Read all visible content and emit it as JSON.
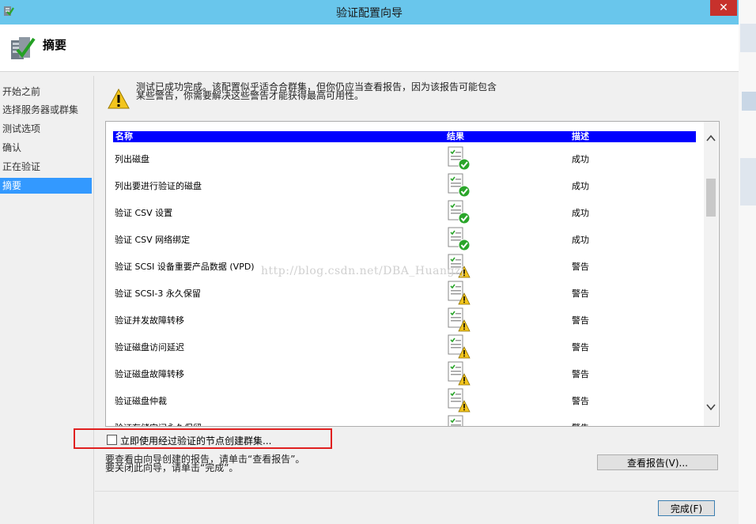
{
  "window": {
    "title": "验证配置向导",
    "close_glyph": "✕"
  },
  "header": {
    "page_title": "摘要"
  },
  "nav": {
    "items": [
      "开始之前",
      "选择服务器或群集",
      "测试选项",
      "确认",
      "正在验证",
      "摘要"
    ],
    "selected_index": 5
  },
  "summary": {
    "line1": "测试已成功完成。该配置似乎适合合群集，但你仍应当查看报告，因为该报告可能包含",
    "line2": "某些警告，你需要解决这些警告才能获得最高可用性。"
  },
  "table": {
    "headers": {
      "name": "名称",
      "result": "结果",
      "desc": "描述"
    },
    "rows": [
      {
        "name": "列出磁盘",
        "result_icon": "success-icon",
        "desc": "成功"
      },
      {
        "name": "列出要进行验证的磁盘",
        "result_icon": "success-icon",
        "desc": "成功"
      },
      {
        "name": "验证 CSV 设置",
        "result_icon": "success-icon",
        "desc": "成功"
      },
      {
        "name": "验证 CSV 网络绑定",
        "result_icon": "success-icon",
        "desc": "成功"
      },
      {
        "name": "验证 SCSI 设备重要产品数据 (VPD)",
        "result_icon": "warning-icon",
        "desc": "警告"
      },
      {
        "name": "验证 SCSI-3 永久保留",
        "result_icon": "warning-icon",
        "desc": "警告"
      },
      {
        "name": "验证并发故障转移",
        "result_icon": "warning-icon",
        "desc": "警告"
      },
      {
        "name": "验证磁盘访问延迟",
        "result_icon": "warning-icon",
        "desc": "警告"
      },
      {
        "name": "验证磁盘故障转移",
        "result_icon": "warning-icon",
        "desc": "警告"
      },
      {
        "name": "验证磁盘仲裁",
        "result_icon": "warning-icon",
        "desc": "警告"
      },
      {
        "name": "验证存储空间永久保留",
        "result_icon": "warning-icon",
        "desc": "警告"
      }
    ]
  },
  "watermark": "http://blog.csdn.net/DBA_Huangzj",
  "checkbox": {
    "label": "立即使用经过验证的节点创建群集...",
    "checked": false
  },
  "info": {
    "line1": "要查看由向导创建的报告，请单击“查看报告”。",
    "line2": "要关闭此向导，请单击“完成”。"
  },
  "buttons": {
    "view_report": "查看报告(V)...",
    "finish": "完成(F)"
  },
  "colors": {
    "titlebar": "#69c6ec",
    "selection": "#3399ff",
    "header_bar": "#0000ff",
    "close": "#c7312c",
    "highlight_box": "#e02020"
  }
}
